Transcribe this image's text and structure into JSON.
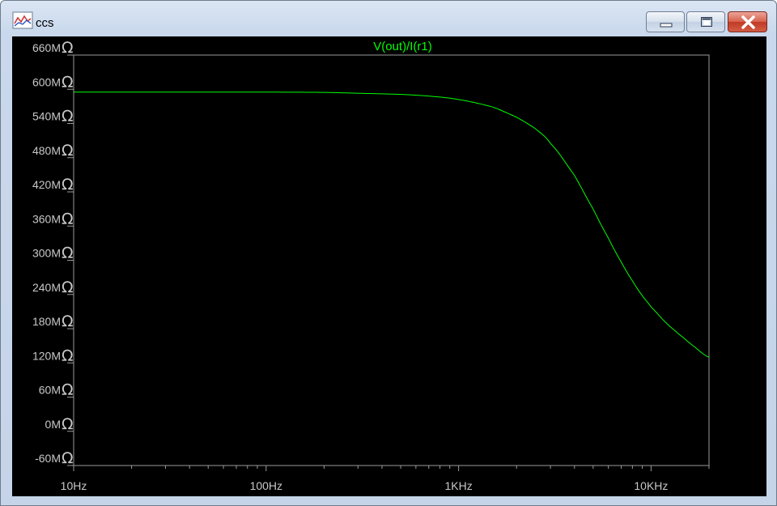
{
  "window": {
    "title": "ccs",
    "icon": "waveform-icon",
    "controls": {
      "minimize_icon": "minimize-icon",
      "maximize_icon": "maximize-icon",
      "close_icon": "close-icon"
    }
  },
  "chart_data": {
    "type": "line",
    "title": "V(out)/I(r1)",
    "x_scale": "log",
    "xlim": [
      10,
      20000
    ],
    "ylim": [
      -60,
      660
    ],
    "y_unit": "MΩ",
    "x_ticks": [
      {
        "value": 10,
        "label": "10Hz"
      },
      {
        "value": 100,
        "label": "100Hz"
      },
      {
        "value": 1000,
        "label": "1KHz"
      },
      {
        "value": 10000,
        "label": "10KHz"
      }
    ],
    "y_ticks": [
      {
        "value": 660,
        "label": "660M"
      },
      {
        "value": 600,
        "label": "600M"
      },
      {
        "value": 540,
        "label": "540M"
      },
      {
        "value": 480,
        "label": "480M"
      },
      {
        "value": 420,
        "label": "420M"
      },
      {
        "value": 360,
        "label": "360M"
      },
      {
        "value": 300,
        "label": "300M"
      },
      {
        "value": 240,
        "label": "240M"
      },
      {
        "value": 180,
        "label": "180M"
      },
      {
        "value": 120,
        "label": "120M"
      },
      {
        "value": 60,
        "label": "60M"
      },
      {
        "value": 0,
        "label": "0M"
      },
      {
        "value": -60,
        "label": "-60M"
      }
    ],
    "series": [
      {
        "name": "V(out)/I(r1)",
        "color": "#00ff00",
        "points": [
          [
            10,
            595
          ],
          [
            50,
            595
          ],
          [
            100,
            595
          ],
          [
            200,
            594.5
          ],
          [
            300,
            593
          ],
          [
            500,
            591
          ],
          [
            700,
            588
          ],
          [
            1000,
            582
          ],
          [
            1500,
            569
          ],
          [
            2000,
            551
          ],
          [
            2500,
            531
          ],
          [
            3000,
            505
          ],
          [
            4000,
            449
          ],
          [
            5000,
            390
          ],
          [
            6000,
            339
          ],
          [
            7000,
            297
          ],
          [
            8000,
            264
          ],
          [
            9000,
            238
          ],
          [
            10000,
            218
          ],
          [
            12000,
            190
          ],
          [
            14000,
            170
          ],
          [
            17000,
            147
          ],
          [
            20000,
            130
          ]
        ]
      }
    ],
    "colors": {
      "background": "#000000",
      "axis": "#9a9a9a",
      "label": "#c8c8c8"
    }
  }
}
